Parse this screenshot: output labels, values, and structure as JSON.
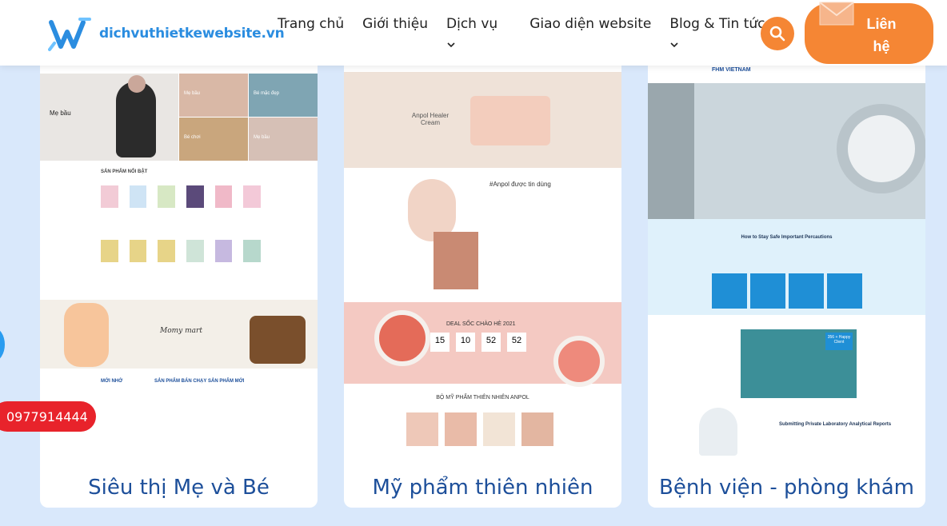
{
  "header": {
    "logo_text": "dichvuthietkewebsite.vn",
    "nav": [
      "Trang chủ",
      "Giới thiệu",
      "Dịch vụ",
      "Giao diện website",
      "Blog & Tin tức"
    ],
    "contact_label": "Liên hệ"
  },
  "cards": [
    {
      "caption": "Siêu thị Mẹ và Bé",
      "hero_title": "Mẹ bầu",
      "tiles": [
        "Mẹ bầu",
        "Bé mặc đẹp",
        "Bé chơi",
        "Mẹ bầu"
      ],
      "section_title": "SẢN PHẨM NỔI BẬT",
      "banner_text": "Momy mart",
      "cols": [
        "MỚI NHỚ",
        "SẢN PHẨM BÁN CHẠY",
        "SẢN PHẨM MỚI"
      ]
    },
    {
      "caption": "Mỹ phẩm thiên nhiên",
      "hero_title": "Anpol Healer Cream",
      "feature_title": "#Anpol được tin dùng",
      "deal_title": "DEAL SỐC CHÀO HÈ 2021",
      "countdown": [
        "15",
        "10",
        "52",
        "52"
      ],
      "products_title": "BỘ MỸ PHẨM THIÊN NHIÊN ANPOL"
    },
    {
      "caption": "Bệnh viện - phòng khám",
      "brand": "FHM VIETNAM",
      "section_title": "How to Stay Safe Important Percautions",
      "badge": "356 + Happy Client",
      "report_title": "Submitting Private Laboratory Analytical Reports"
    }
  ],
  "phone": "0977914444",
  "colors": {
    "accent": "#f58634",
    "brand_blue": "#2b8de0",
    "caption_blue": "#1d4f9a",
    "bg": "#d9e8fb"
  }
}
